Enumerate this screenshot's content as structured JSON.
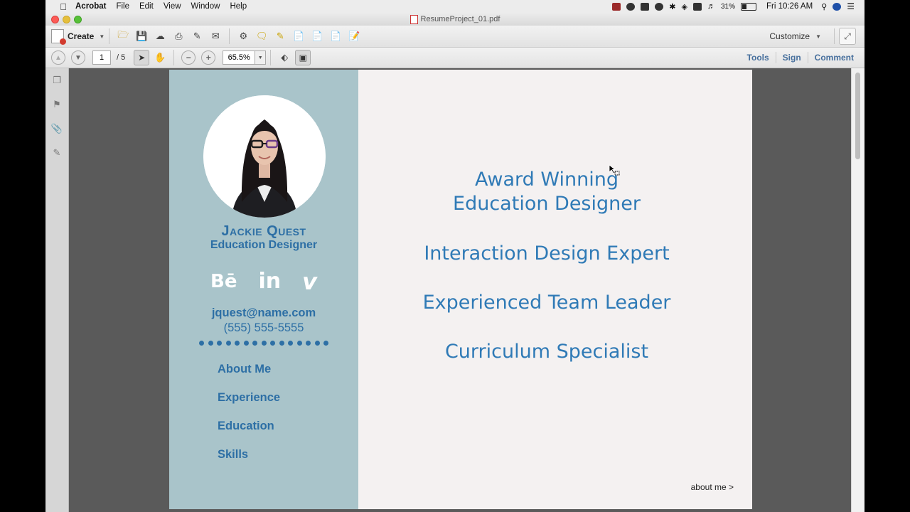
{
  "menubar": {
    "app": "Acrobat",
    "items": [
      "File",
      "Edit",
      "View",
      "Window",
      "Help"
    ],
    "battery": "31%",
    "clock": "Fri 10:26 AM"
  },
  "window": {
    "title": "ResumeProject_01.pdf"
  },
  "toolbar": {
    "create_label": "Create",
    "customize_label": "Customize"
  },
  "pagenav": {
    "current_page": "1",
    "total_pages": "/ 5",
    "zoom": "65.5%",
    "tools_label": "Tools",
    "sign_label": "Sign",
    "comment_label": "Comment"
  },
  "resume": {
    "name": "Jackie Quest",
    "role": "Education Designer",
    "social": [
      "Bē",
      "in",
      "v"
    ],
    "email": "jquest@name.com",
    "phone": "(555) 555-5555",
    "menu": [
      "About Me",
      "Experience",
      "Education",
      "Skills"
    ],
    "headline_1a": "Award Winning",
    "headline_1b": "Education Designer",
    "headline_2": "Interaction Design Expert",
    "headline_3": "Experienced Team Leader",
    "headline_4": "Curriculum Specialist",
    "about_link": "about me >"
  },
  "colors": {
    "sidebar_bg": "#a9c4ca",
    "accent_blue": "#2d6fa5",
    "page_bg": "#f4f1f1"
  }
}
